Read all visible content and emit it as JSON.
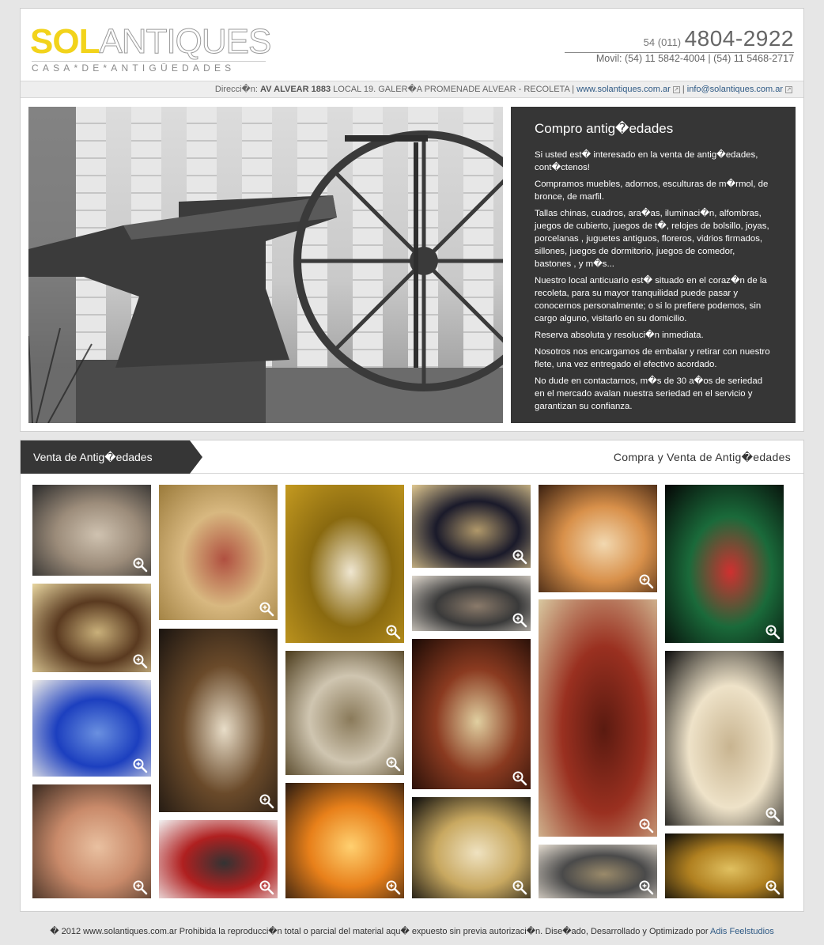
{
  "header": {
    "logo": {
      "sol": "SOL",
      "antiques": "ANTIQUES",
      "tagline": "CASA*DE*ANTIGÜEDADES"
    },
    "phone": {
      "prefix": "54 (011)",
      "number": "4804-2922"
    },
    "mobile": "Movil: (54) 11 5842-4004  |  (54) 11 5468-2717",
    "address_label": "Direcci�n:",
    "address_bold": "AV ALVEAR 1883",
    "address_rest": "LOCAL 19. GALER�A PROMENADE ALVEAR - RECOLETA |",
    "website": "www.solantiques.com.ar",
    "email": "info@solantiques.com.ar",
    "sep": "|"
  },
  "hero": {
    "title": "Compro antig�edades",
    "paragraphs": [
      "Si usted est� interesado en la venta de antig�edades, cont�ctenos!",
      "Compramos muebles, adornos, esculturas de m�rmol, de bronce, de marfil.",
      "Tallas chinas, cuadros, ara�as, iluminaci�n, alfombras, juegos de cubierto, juegos de t�, relojes de bolsillo, joyas, porcelanas , juguetes antiguos, floreros, vidrios firmados, sillones, juegos de dormitorio, juegos de comedor, bastones , y m�s...",
      "Nuestro local anticuario est� situado en el coraz�n de la recoleta, para su mayor tranquilidad puede pasar y conocernos personalmente; o si lo prefiere podemos, sin cargo alguno, visitarlo en su domicilio.",
      "Reserva absoluta y resoluci�n inmediata.",
      "Nosotros nos encargamos de embalar y retirar con nuestro flete, una vez entregado el efectivo acordado.",
      "No dude en contactarnos, m�s de 30 a�os de seriedad en el mercado avalan nuestra seriedad en el servicio y garantizan su confianza."
    ]
  },
  "gallery": {
    "tab_label": "Venta de Antig�edades",
    "title": "Compra y Venta de Antig�edades",
    "items": [
      {
        "name": "silver-box",
        "colors": [
          "#2a2a2a",
          "#9c8c7a",
          "#cfc2b0"
        ]
      },
      {
        "name": "pierrot-sculpture",
        "colors": [
          "#e8d6a0",
          "#5a3a20",
          "#c9b07a"
        ]
      },
      {
        "name": "blue-glass-vase",
        "colors": [
          "#f0eee8",
          "#1c3fbf",
          "#6a90e0"
        ]
      },
      {
        "name": "woman-portrait-painting",
        "colors": [
          "#3a2a20",
          "#c98a6a",
          "#e9c0a0"
        ]
      },
      {
        "name": "framed-portrait-painting",
        "colors": [
          "#9a7a3a",
          "#d8b880",
          "#b05040"
        ]
      },
      {
        "name": "clown-bust",
        "colors": [
          "#1a1410",
          "#6a4a2a",
          "#e8ddc8"
        ]
      },
      {
        "name": "red-toy-truck",
        "colors": [
          "#f2f2f2",
          "#b02020",
          "#333333"
        ]
      },
      {
        "name": "cameo-brooch",
        "colors": [
          "#c49a20",
          "#8a6a10",
          "#efe6d0"
        ]
      },
      {
        "name": "glass-vase",
        "colors": [
          "#4a3a1a",
          "#cfc5b0",
          "#8a7a5a"
        ]
      },
      {
        "name": "glass-lamps",
        "colors": [
          "#2a1a10",
          "#e8801a",
          "#ffd070"
        ]
      },
      {
        "name": "black-sofa",
        "colors": [
          "#e0c890",
          "#1a1a2a",
          "#b0986a"
        ]
      },
      {
        "name": "toy-car",
        "colors": [
          "#ddd6cc",
          "#3a3a3a",
          "#8a7a6a"
        ]
      },
      {
        "name": "ivory-figure",
        "colors": [
          "#1a0a05",
          "#8a3a20",
          "#e0cfa0"
        ]
      },
      {
        "name": "ivory-figurines",
        "colors": [
          "#0a0a0a",
          "#c8a860",
          "#efe2c0"
        ]
      },
      {
        "name": "cameo-oval",
        "colors": [
          "#3a2010",
          "#d8904a",
          "#f2d8b0"
        ]
      },
      {
        "name": "pierrot-lamp",
        "colors": [
          "#d8c8a0",
          "#9a3020",
          "#5a1a10"
        ]
      },
      {
        "name": "silver-car",
        "colors": [
          "#e4dcd0",
          "#4a4a4a",
          "#9a8a6a"
        ]
      },
      {
        "name": "balloon-lady-figurine",
        "colors": [
          "#050505",
          "#1a6a3a",
          "#d03030"
        ]
      },
      {
        "name": "ivory-boy-fish",
        "colors": [
          "#0a0a0a",
          "#eee2c8",
          "#c8b490"
        ]
      },
      {
        "name": "gilt-sconces",
        "colors": [
          "#0a0a0a",
          "#b08020",
          "#e0c060"
        ]
      }
    ]
  },
  "footer": {
    "text": "� 2012 www.solantiques.com.ar Prohibida la reproducci�n total o parcial del material aqu� expuesto sin previa autorizaci�n. Dise�ado, Desarrollado y Optimizado por",
    "link": "Adis Feelstudios"
  }
}
